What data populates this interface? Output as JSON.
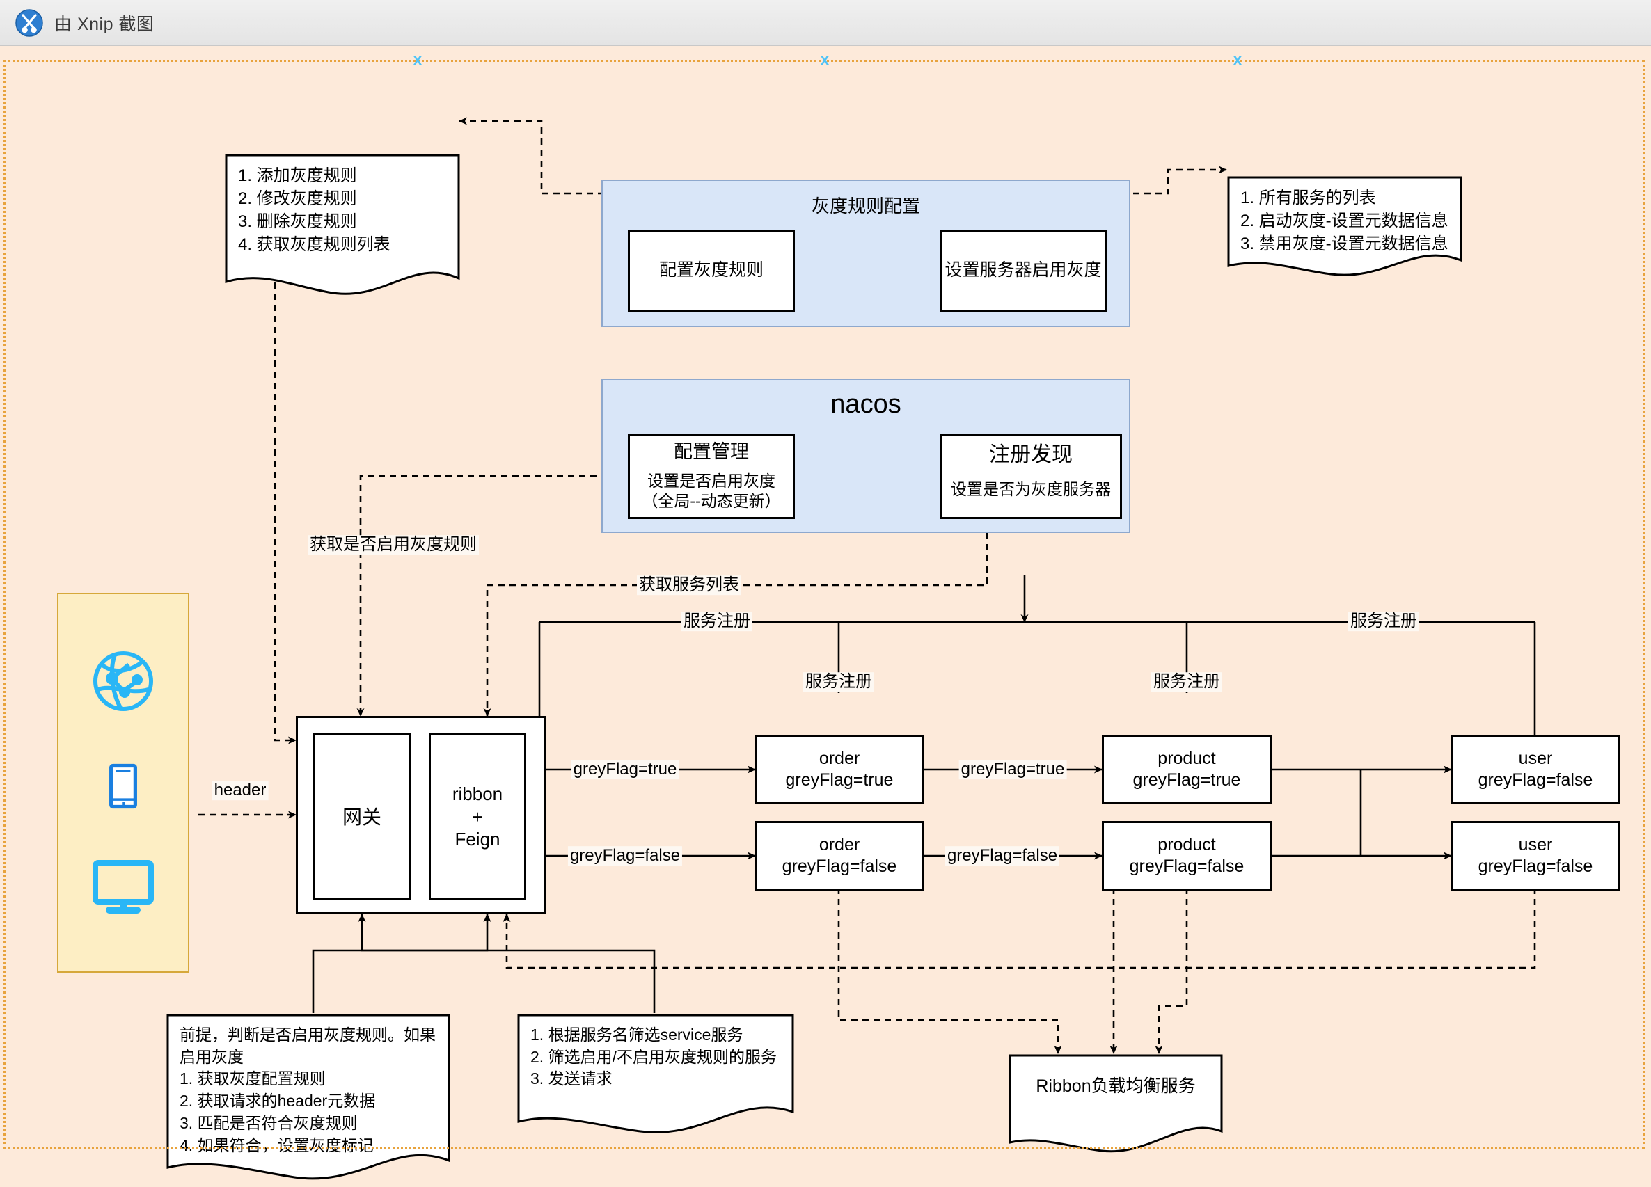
{
  "window": {
    "title": "由 Xnip 截图",
    "app_icon": "xnip-scissors-icon"
  },
  "colors": {
    "canvas_bg": "#fdeada",
    "group_bg": "#d9e6f8",
    "group_border": "#8ea8cd",
    "client_bg": "#fdeec4",
    "client_border": "#d6a83a",
    "selection_border": "#e8a33d",
    "handle": "#4fc3f7",
    "icon_cyan": "#29b6f6",
    "stroke": "#000000"
  },
  "notes": {
    "grey_rule_ops": "1. 添加灰度规则\n2. 修改灰度规则\n3. 删除灰度规则\n4. 获取灰度规则列表",
    "service_meta_ops": "1. 所有服务的列表\n2. 启动灰度-设置元数据信息\n3. 禁用灰度-设置元数据信息",
    "gateway_logic": "前提，判断是否启用灰度规则。如果\n启用灰度\n1. 获取灰度配置规则\n2. 获取请求的header元数据\n3. 匹配是否符合灰度规则\n4. 如果符合，设置灰度标记",
    "ribbon_logic": "1. 根据服务名筛选service服务\n2. 筛选启用/不启用灰度规则的服务\n3. 发送请求",
    "ribbon_lb": "Ribbon负载均衡服务"
  },
  "groups": {
    "grey_config": {
      "title": "灰度规则配置",
      "boxes": [
        {
          "label": "配置灰度规则"
        },
        {
          "label": "设置服务器启用灰度"
        }
      ]
    },
    "nacos": {
      "title": "nacos",
      "boxes": [
        {
          "title": "配置管理",
          "sub": "设置是否启用灰度\n（全局--动态更新）"
        },
        {
          "title": "注册发现",
          "sub": "设置是否为灰度服务器"
        }
      ]
    }
  },
  "client_panel": {
    "icons": [
      {
        "name": "globe-network-icon"
      },
      {
        "name": "mobile-phone-icon"
      },
      {
        "name": "desktop-monitor-icon"
      }
    ]
  },
  "gateway": {
    "left_label": "网关",
    "right_label": "ribbon\n+\nFeign"
  },
  "services": {
    "grey_row": [
      {
        "name": "order",
        "flag": "greyFlag=true"
      },
      {
        "name": "product",
        "flag": "greyFlag=true"
      },
      {
        "name": "user",
        "flag": "greyFlag=false"
      }
    ],
    "normal_row": [
      {
        "name": "order",
        "flag": "greyFlag=false"
      },
      {
        "name": "product",
        "flag": "greyFlag=false"
      },
      {
        "name": "user",
        "flag": "greyFlag=false"
      }
    ]
  },
  "edge_labels": {
    "header": "header",
    "get_grey_enabled": "获取是否启用灰度规则",
    "get_service_list": "获取服务列表",
    "register_1": "服务注册",
    "register_2": "服务注册",
    "register_3": "服务注册",
    "register_4": "服务注册",
    "grey_true_1": "greyFlag=true",
    "grey_true_2": "greyFlag=true",
    "grey_false_1": "greyFlag=false",
    "grey_false_2": "greyFlag=false"
  }
}
